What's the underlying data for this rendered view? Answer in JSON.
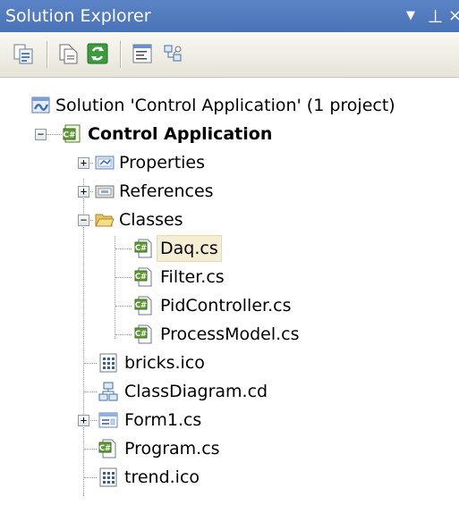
{
  "panel": {
    "title": "Solution Explorer",
    "menu_glyph": "▼",
    "pin_glyph": "⊥",
    "close_glyph": "×"
  },
  "toolbar": {
    "buttons": [
      {
        "name": "properties-button",
        "icon": "properties-icon"
      },
      {
        "name": "show-all-files-button",
        "icon": "show-all-files-icon"
      },
      {
        "name": "refresh-button",
        "icon": "refresh-icon"
      },
      {
        "name": "view-code-button",
        "icon": "view-code-icon"
      },
      {
        "name": "view-class-diagram-button",
        "icon": "class-diagram-icon"
      }
    ]
  },
  "tree": {
    "solution": "Solution 'Control Application' (1 project)",
    "project": "Control Application",
    "items": {
      "properties": "Properties",
      "references": "References",
      "classes": "Classes",
      "daq": "Daq.cs",
      "filter": "Filter.cs",
      "pid": "PidController.cs",
      "process": "ProcessModel.cs",
      "bricks": "bricks.ico",
      "classdiagram": "ClassDiagram.cd",
      "form1": "Form1.cs",
      "program": "Program.cs",
      "trend": "trend.ico"
    },
    "expanders": {
      "plus": "+",
      "minus": "−"
    },
    "selected_item": "Daq.cs",
    "colors": {
      "selection_bg": "#f6eed4",
      "title_bg": "#4a72b6"
    }
  }
}
